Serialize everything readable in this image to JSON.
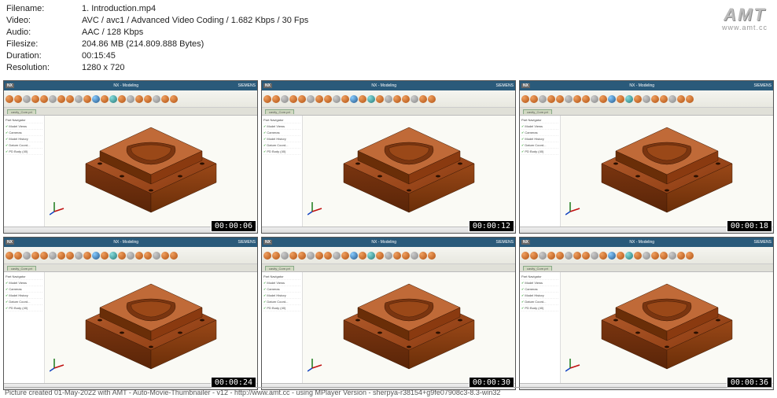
{
  "meta": {
    "filename_label": "Filename:",
    "filename": "1. Introduction.mp4",
    "video_label": "Video:",
    "video": "AVC / avc1 / Advanced Video Coding / 1.682 Kbps / 30 Fps",
    "audio_label": "Audio:",
    "audio": "AAC / 128 Kbps",
    "filesize_label": "Filesize:",
    "filesize": "204.86 MB (214.809.888 Bytes)",
    "duration_label": "Duration:",
    "duration": "00:15:45",
    "resolution_label": "Resolution:",
    "resolution": "1280 x 720"
  },
  "logo": {
    "text": "AMT",
    "url": "www.amt.cc"
  },
  "app": {
    "nx": "NX",
    "titlebar_center": "NX - Modeling",
    "titlebar_right": "SIEMENS",
    "tab": "cavity_Core.prt",
    "sidebar_items": [
      "Part Navigator",
      "Model Views",
      "Cameras",
      "Model History",
      "Datum Coord...",
      "PD Body (40)"
    ]
  },
  "thumbs": [
    {
      "ts": "00:00:06"
    },
    {
      "ts": "00:00:12"
    },
    {
      "ts": "00:00:18"
    },
    {
      "ts": "00:00:24"
    },
    {
      "ts": "00:00:30"
    },
    {
      "ts": "00:00:36"
    }
  ],
  "footer": "Picture created 01-May-2022 with AMT - Auto-Movie-Thumbnailer - v12 - http://www.amt.cc - using MPlayer Version - sherpya-r38154+g9fe07908c3-8.3-win32"
}
